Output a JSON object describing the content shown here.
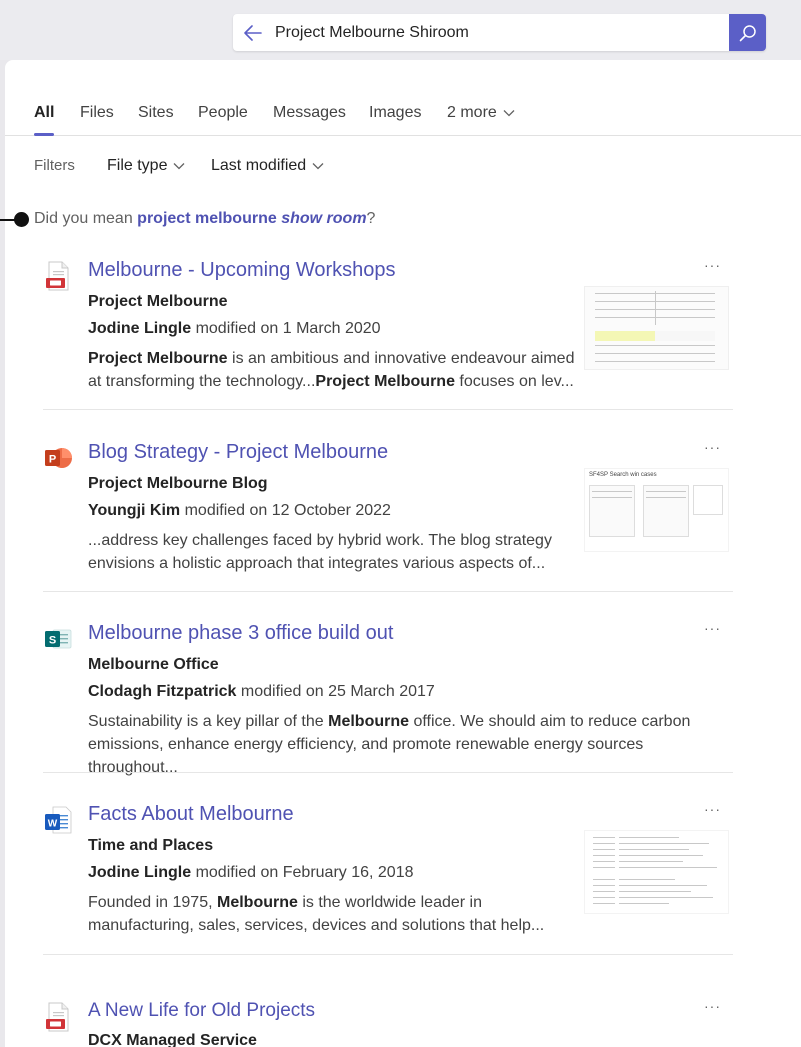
{
  "search": {
    "query": "Project Melbourne Shiroom"
  },
  "tabs": [
    {
      "label": "All",
      "active": true
    },
    {
      "label": "Files"
    },
    {
      "label": "Sites"
    },
    {
      "label": "People"
    },
    {
      "label": "Messages"
    },
    {
      "label": "Images"
    },
    {
      "label": "2 more"
    }
  ],
  "filters": {
    "label": "Filters",
    "file_type": "File type",
    "last_modified": "Last modified"
  },
  "did_you_mean": {
    "prefix": "Did you mean",
    "suggestion_plain": "project melbourne",
    "suggestion_italic": "show room",
    "suffix": "?"
  },
  "more_label": "···",
  "results": [
    {
      "icon": "pdf-file-icon",
      "title": "Melbourne - Upcoming Workshops",
      "location": "Project Melbourne",
      "author": "Jodine Lingle",
      "modified_text": "modified on 1 March 2020",
      "snippet_1_bold": "Project Melbourne",
      "snippet_1": " is an ambitious and innovative endeavour aimed",
      "snippet_2": "at transforming the technology...",
      "snippet_2_bold": "Project Melbourne",
      "snippet_2_tail": " focuses on lev..."
    },
    {
      "icon": "powerpoint-file-icon",
      "title": "Blog Strategy - Project Melbourne",
      "location": "Project Melbourne Blog",
      "author": "Youngji Kim",
      "modified_text": "modified on 12 October 2022",
      "snippet_1": "...address key challenges faced by hybrid work. The blog strategy",
      "snippet_2": "envisions a holistic approach that integrates various aspects of...",
      "thumb_caption": "SF4SP Search win cases"
    },
    {
      "icon": "sharepoint-site-icon",
      "title": "Melbourne phase 3 office build out",
      "location": "Melbourne Office",
      "author": "Clodagh Fitzpatrick",
      "modified_text": "modified on 25 March 2017",
      "snippet_1": "Sustainability is a key pillar of the ",
      "snippet_1_bold": "Melbourne",
      "snippet_1_tail": " office. We should aim to reduce carbon",
      "snippet_2": "emissions, enhance energy efficiency, and promote renewable energy sources throughout..."
    },
    {
      "icon": "word-file-icon",
      "title": "Facts About Melbourne",
      "location": "Time and Places",
      "author": "Jodine Lingle",
      "modified_text": "modified on February 16, 2018",
      "snippet_1": "Founded in 1975, ",
      "snippet_1_bold": "Melbourne",
      "snippet_1_tail": " is the worldwide leader in",
      "snippet_2": "manufacturing, sales, services, devices and solutions that help..."
    },
    {
      "icon": "pdf-file-icon",
      "title": "A New Life for Old Projects",
      "location": "DCX Managed Service"
    }
  ]
}
